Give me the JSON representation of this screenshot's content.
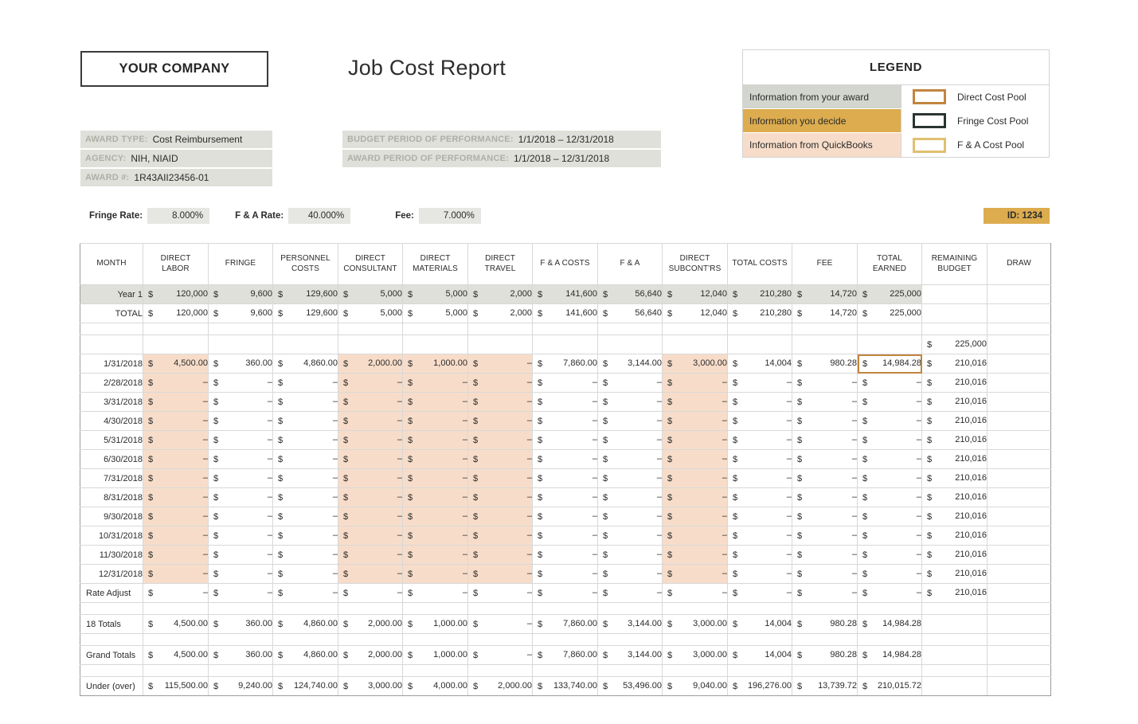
{
  "header": {
    "company": "YOUR COMPANY",
    "title": "Job Cost Report"
  },
  "award_info_left": [
    {
      "label": "AWARD TYPE:",
      "value": "Cost Reimbursement"
    },
    {
      "label": "AGENCY:",
      "value": "NIH, NIAID"
    },
    {
      "label": "AWARD #:",
      "value": "1R43AII23456-01"
    }
  ],
  "award_info_right": [
    {
      "label": "BUDGET PERIOD OF PERFORMANCE:",
      "value": "1/1/2018 – 12/31/2018"
    },
    {
      "label": "AWARD PERIOD OF PERFORMANCE:",
      "value": "1/1/2018 – 12/31/2018"
    }
  ],
  "legend": {
    "title": "LEGEND",
    "rows": [
      {
        "source": "Information from your award",
        "source_bg": "#d3d6ce",
        "pool": "Direct Cost Pool",
        "swatch_color": "#c2853f"
      },
      {
        "source": "Information you decide",
        "source_bg": "#dcac4e",
        "pool": "Fringe Cost Pool",
        "swatch_color": "#2b3530"
      },
      {
        "source": "Information from QuickBooks",
        "source_bg": "#f7ddc9",
        "pool": "F & A Cost Pool",
        "swatch_color": "#e0c070"
      }
    ]
  },
  "rates": {
    "fringe_label": "Fringe Rate:",
    "fringe_value": "8.000%",
    "fa_label": "F & A Rate:",
    "fa_value": "40.000%",
    "fee_label": "Fee:",
    "fee_value": "7.000%",
    "id_badge": "ID: 1234"
  },
  "table": {
    "columns": [
      "MONTH",
      "DIRECT LABOR",
      "FRINGE",
      "PERSONNEL COSTS",
      "DIRECT CONSULTANT",
      "DIRECT MATERIALS",
      "DIRECT TRAVEL",
      "F & A COSTS",
      "F & A",
      "DIRECT SUBCONT'RS",
      "TOTAL COSTS",
      "FEE",
      "TOTAL EARNED",
      "REMAINING BUDGET",
      "DRAW"
    ],
    "budget_rows": [
      {
        "label": "Year 1",
        "shaded": true,
        "values": [
          "120,000",
          "9,600",
          "129,600",
          "5,000",
          "5,000",
          "2,000",
          "141,600",
          "56,640",
          "12,040",
          "210,280",
          "14,720",
          "225,000",
          "",
          ""
        ]
      },
      {
        "label": "TOTAL",
        "shaded": false,
        "values": [
          "120,000",
          "9,600",
          "129,600",
          "5,000",
          "5,000",
          "2,000",
          "141,600",
          "56,640",
          "12,040",
          "210,280",
          "14,720",
          "225,000",
          "",
          ""
        ]
      }
    ],
    "opening_balance_row": {
      "label": "",
      "values": [
        "",
        "",
        "",
        "",
        "",
        "",
        "",
        "",
        "",
        "",
        "",
        "",
        "225,000",
        ""
      ]
    },
    "monthly_rows": [
      {
        "label": "1/31/2018",
        "values": [
          "4,500.00",
          "360.00",
          "4,860.00",
          "2,000.00",
          "1,000.00",
          "–",
          "7,860.00",
          "3,144.00",
          "3,000.00",
          "14,004",
          "980.28",
          "14,984.28",
          "210,016",
          ""
        ]
      },
      {
        "label": "2/28/2018",
        "values": [
          "–",
          "–",
          "–",
          "–",
          "–",
          "–",
          "–",
          "–",
          "–",
          "–",
          "–",
          "–",
          "210,016",
          ""
        ]
      },
      {
        "label": "3/31/2018",
        "values": [
          "–",
          "–",
          "–",
          "–",
          "–",
          "–",
          "–",
          "–",
          "–",
          "–",
          "–",
          "–",
          "210,016",
          ""
        ]
      },
      {
        "label": "4/30/2018",
        "values": [
          "–",
          "–",
          "–",
          "–",
          "–",
          "–",
          "–",
          "–",
          "–",
          "–",
          "–",
          "–",
          "210,016",
          ""
        ]
      },
      {
        "label": "5/31/2018",
        "values": [
          "–",
          "–",
          "–",
          "–",
          "–",
          "–",
          "–",
          "–",
          "–",
          "–",
          "–",
          "–",
          "210,016",
          ""
        ]
      },
      {
        "label": "6/30/2018",
        "values": [
          "–",
          "–",
          "–",
          "–",
          "–",
          "–",
          "–",
          "–",
          "–",
          "–",
          "–",
          "–",
          "210,016",
          ""
        ]
      },
      {
        "label": "7/31/2018",
        "values": [
          "–",
          "–",
          "–",
          "–",
          "–",
          "–",
          "–",
          "–",
          "–",
          "–",
          "–",
          "–",
          "210,016",
          ""
        ]
      },
      {
        "label": "8/31/2018",
        "values": [
          "–",
          "–",
          "–",
          "–",
          "–",
          "–",
          "–",
          "–",
          "–",
          "–",
          "–",
          "–",
          "210,016",
          ""
        ]
      },
      {
        "label": "9/30/2018",
        "values": [
          "–",
          "–",
          "–",
          "–",
          "–",
          "–",
          "–",
          "–",
          "–",
          "–",
          "–",
          "–",
          "210,016",
          ""
        ]
      },
      {
        "label": "10/31/2018",
        "values": [
          "–",
          "–",
          "–",
          "–",
          "–",
          "–",
          "–",
          "–",
          "–",
          "–",
          "–",
          "–",
          "210,016",
          ""
        ]
      },
      {
        "label": "11/30/2018",
        "values": [
          "–",
          "–",
          "–",
          "–",
          "–",
          "–",
          "–",
          "–",
          "–",
          "–",
          "–",
          "–",
          "210,016",
          ""
        ]
      },
      {
        "label": "12/31/2018",
        "values": [
          "–",
          "–",
          "–",
          "–",
          "–",
          "–",
          "–",
          "–",
          "–",
          "–",
          "–",
          "–",
          "210,016",
          ""
        ]
      }
    ],
    "rate_adjust_row": {
      "label": "Rate Adjust",
      "values": [
        "–",
        "–",
        "–",
        "–",
        "–",
        "–",
        "–",
        "–",
        "–",
        "–",
        "–",
        "–",
        "210,016",
        ""
      ]
    },
    "summary_rows": [
      {
        "label": "18 Totals",
        "values": [
          "4,500.00",
          "360.00",
          "4,860.00",
          "2,000.00",
          "1,000.00",
          "–",
          "7,860.00",
          "3,144.00",
          "3,000.00",
          "14,004",
          "980.28",
          "14,984.28",
          "",
          ""
        ]
      },
      {
        "label": "Grand Totals",
        "values": [
          "4,500.00",
          "360.00",
          "4,860.00",
          "2,000.00",
          "1,000.00",
          "–",
          "7,860.00",
          "3,144.00",
          "3,000.00",
          "14,004",
          "980.28",
          "14,984.28",
          "",
          ""
        ]
      },
      {
        "label": "Under (over)",
        "values": [
          "115,500.00",
          "9,240.00",
          "124,740.00",
          "3,000.00",
          "4,000.00",
          "2,000.00",
          "133,740.00",
          "53,496.00",
          "9,040.00",
          "196,276.00",
          "13,739.72",
          "210,015.72",
          "",
          ""
        ]
      }
    ],
    "highlighted_column_indices": [
      0,
      3,
      4,
      5,
      8
    ],
    "dollar_sign": "$",
    "selected_cell": {
      "row": "1/31/2018",
      "column": "TOTAL EARNED",
      "value": "14,984.28",
      "border_color": "#c2853f"
    }
  }
}
